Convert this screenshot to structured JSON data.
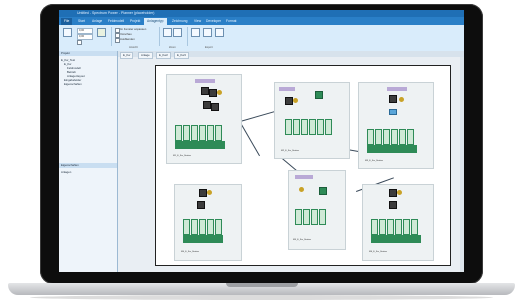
{
  "window": {
    "title": "Untitled - Spectrum Power - Planner (placeholder)"
  },
  "ribbon": {
    "tabs": [
      "File",
      "Start",
      "Anlage",
      "Feldmodell",
      "Projekt",
      "Anlagentyp",
      "Zeichnung",
      "View",
      "Developer",
      "Format"
    ],
    "active_tab": "Anlagentyp",
    "group_labels": [
      "Ansicht",
      "Zoom",
      "Export"
    ],
    "field_values": [
      "0,00",
      "0,00"
    ],
    "check_labels": [
      "Im Fenster anpassen",
      "Vorschau",
      "Ausblenden"
    ]
  },
  "left_panel": {
    "tree_header": "Projekt",
    "tree_items": [
      "E_Kw_Test",
      "E_Kw",
      "Feldmodell",
      "Betrieb",
      "Anlagenlayout",
      "Eingabefelder",
      "Eigenschaften"
    ],
    "bottom_header": "Eigenschaften",
    "bottom_items": [
      "Anlagen"
    ]
  },
  "documents": {
    "tabs": [
      "E_Kw",
      "Anlage",
      "E_Kw2",
      "E_Kw3"
    ]
  },
  "diagram": {
    "clusters": [
      {
        "label": "M1_E_Kw_Station"
      },
      {
        "label": "M2_E_Kw_Station"
      },
      {
        "label": "M3_E_Kw_Station"
      },
      {
        "label": "M4_E_Kw_Station"
      },
      {
        "label": "M5_E_Kw_Station"
      },
      {
        "label": "M6_E_Kw_Station"
      }
    ]
  },
  "colors": {
    "ribbon": "#d9ecfb",
    "titlebar": "#1f6fb5",
    "rack_green": "#2e8b57",
    "header_purple": "#b9a9d6"
  }
}
